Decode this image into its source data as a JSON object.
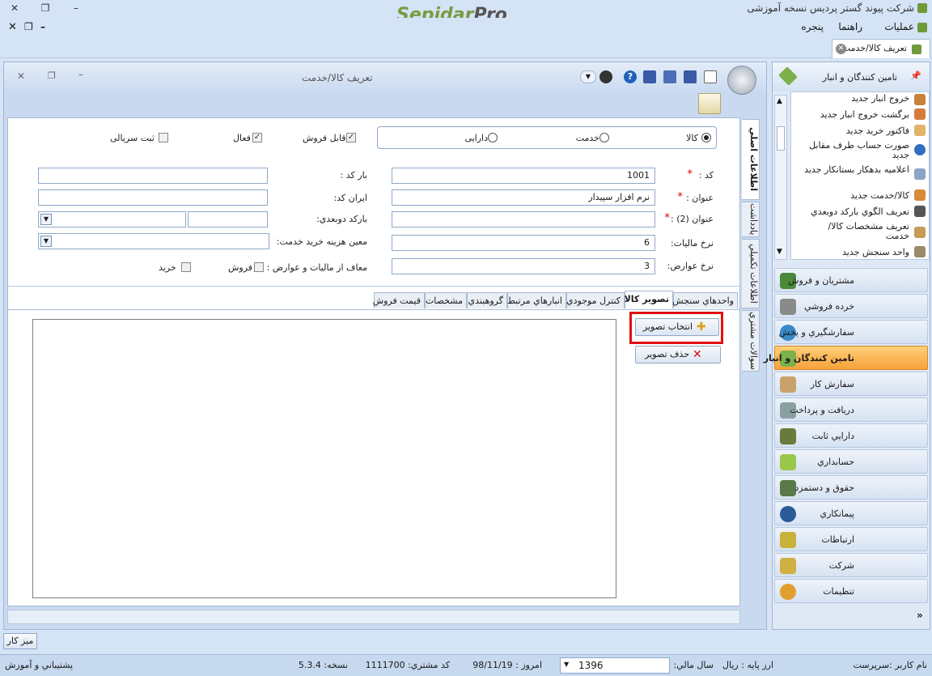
{
  "app": {
    "title": "شرکت پیوند گستر پردیس نسخه آموزشی",
    "brand_main": "Sepidar",
    "brand_suffix": "Pro"
  },
  "menu": {
    "items": [
      "عملیات",
      "راهنما",
      "پنجره"
    ]
  },
  "doc_tab": {
    "label": "تعريف كالا/خدمت"
  },
  "window": {
    "title": "تعريف كالا/خدمت"
  },
  "form": {
    "type_options": [
      "كالا",
      "خدمت",
      "دارایی"
    ],
    "type_selected": "كالا",
    "checkboxes": [
      {
        "label": "قابل فروش",
        "checked": true
      },
      {
        "label": "فعال",
        "checked": true
      },
      {
        "label": "ثبت سریالی",
        "checked": false
      }
    ],
    "code_label": "كد :",
    "code_value": "1001",
    "title_label": "عنوان :",
    "title_value": "نرم افزار سپیدار",
    "title2_label": "عنوان (2) :",
    "title2_value": "",
    "tax_rate_label": "نرخ ماليات:",
    "tax_rate_value": "6",
    "duty_rate_label": "نرخ عوارض:",
    "duty_rate_value": "3",
    "barcode_label": "بار كد :",
    "iran_code_label": "ايران كد:",
    "secondary_barcode_label": "باركد دوبعدي:",
    "service_cost_label": "معين هزينه خريد خدمت:",
    "exempt_label": "معاف از ماليات و عوارض :",
    "exempt_sale": "فروش",
    "exempt_purchase": "خريد"
  },
  "tabs": [
    "واحدهاي سنجش",
    "تصوير كالا",
    "كنترل موجودي",
    "انبارهاي مرتبط",
    "گروهبندي",
    "مشخصات",
    "قيمت فروش"
  ],
  "active_tab": "تصوير كالا",
  "side_tabs": [
    "اطلاعات اصلي",
    "يادداشت",
    "اطلاعات تكميلي",
    "سوالات مشتري"
  ],
  "image_tab": {
    "select_button": "انتخاب تصوير",
    "delete_button": "حذف تصوير"
  },
  "right_panel": {
    "header": "تامين كنندگان و انبار",
    "sub_items": [
      "خروج انبار جديد",
      "برگشت خروج انبار جديد",
      "فاكتور خريد جديد",
      "صورت حساب طرف مقابل جديد",
      "اعلاميه بدهكار بستانكار جديد",
      "كالا/خدمت جديد",
      "تعريف الگوي باركد دوبعدي",
      "تعريف مشخصات كالا/خدمت",
      "واحد سنجش جديد"
    ],
    "nav_items": [
      "مشتريان و فروش",
      "خرده فروشي",
      "سفارشگيري و پخش",
      "تامين كنندگان و انبار",
      "سفارش كار",
      "دريافت و پرداخت",
      "دارايي ثابت",
      "حسابداري",
      "حقوق و دستمزد",
      "پيمانكاري",
      "ارتباطات",
      "شركت",
      "تنظيمات"
    ],
    "active_nav": "تامين كنندگان و انبار"
  },
  "bottom": {
    "desk_button": "ميز كار"
  },
  "status": {
    "user": "نام كاربر :سرپرست",
    "base_currency": "ارز پايه :   ريال",
    "fiscal_year_label": "سال مالي:",
    "fiscal_year_value": "1396",
    "today": "امروز :  98/11/19",
    "customer_code": "كد مشتري:   1111700",
    "version": "نسخه:   5.3.4",
    "support": "پشتيباني و آموزش"
  },
  "colors": {
    "accent": "#f6a23a",
    "highlight": "#e01010",
    "brand_green": "#7a9b40"
  }
}
